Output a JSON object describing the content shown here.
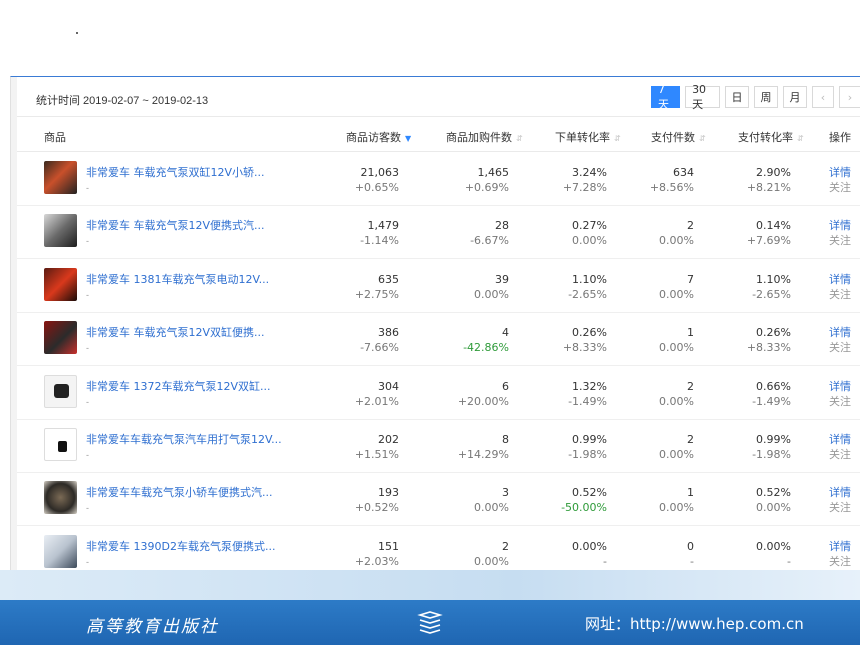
{
  "stats": {
    "time_label": "统计时间 2019-02-07 ~ 2019-02-13",
    "ranges": [
      "7天",
      "30天",
      "日",
      "周",
      "月"
    ],
    "active_range": "7天",
    "prev_icon": "chevron-left-icon",
    "next_icon": "chevron-right-icon"
  },
  "table": {
    "headers": {
      "product": "商品",
      "visitors": "商品访客数",
      "cart": "商品加购件数",
      "order_rate": "下单转化率",
      "paid_items": "支付件数",
      "pay_rate": "支付转化率",
      "ops": "操作"
    },
    "sort_active": "visitors",
    "rows": [
      {
        "name": "非常爱车 车载充气泵双缸12V小轿...",
        "dash": "-",
        "visitors": "21,063",
        "visitors_d": "+0.65%",
        "cart": "1,465",
        "cart_d": "+0.69%",
        "order_rate": "3.24%",
        "order_rate_d": "+7.28%",
        "paid": "634",
        "paid_d": "+8.56%",
        "pay_rate": "2.90%",
        "pay_rate_d": "+8.21%",
        "detail": "详情",
        "follow": "关注"
      },
      {
        "name": "非常爱车 车载充气泵12V便携式汽...",
        "dash": "-",
        "visitors": "1,479",
        "visitors_d": "-1.14%",
        "cart": "28",
        "cart_d": "-6.67%",
        "order_rate": "0.27%",
        "order_rate_d": "0.00%",
        "paid": "2",
        "paid_d": "0.00%",
        "pay_rate": "0.14%",
        "pay_rate_d": "+7.69%",
        "detail": "详情",
        "follow": "关注"
      },
      {
        "name": "非常爱车 1381车载充气泵电动12V...",
        "dash": "-",
        "visitors": "635",
        "visitors_d": "+2.75%",
        "cart": "39",
        "cart_d": "0.00%",
        "order_rate": "1.10%",
        "order_rate_d": "-2.65%",
        "paid": "7",
        "paid_d": "0.00%",
        "pay_rate": "1.10%",
        "pay_rate_d": "-2.65%",
        "detail": "详情",
        "follow": "关注"
      },
      {
        "name": "非常爱车 车载充气泵12V双缸便携...",
        "dash": "-",
        "visitors": "386",
        "visitors_d": "-7.66%",
        "cart": "4",
        "cart_d": "-42.86%",
        "cart_d_neg": true,
        "order_rate": "0.26%",
        "order_rate_d": "+8.33%",
        "paid": "1",
        "paid_d": "0.00%",
        "pay_rate": "0.26%",
        "pay_rate_d": "+8.33%",
        "detail": "详情",
        "follow": "关注"
      },
      {
        "name": "非常爱车 1372车载充气泵12V双缸...",
        "dash": "-",
        "visitors": "304",
        "visitors_d": "+2.01%",
        "cart": "6",
        "cart_d": "+20.00%",
        "order_rate": "1.32%",
        "order_rate_d": "-1.49%",
        "paid": "2",
        "paid_d": "0.00%",
        "pay_rate": "0.66%",
        "pay_rate_d": "-1.49%",
        "detail": "详情",
        "follow": "关注"
      },
      {
        "name": "非常爱车车载充气泵汽车用打气泵12V...",
        "dash": "-",
        "visitors": "202",
        "visitors_d": "+1.51%",
        "cart": "8",
        "cart_d": "+14.29%",
        "order_rate": "0.99%",
        "order_rate_d": "-1.98%",
        "paid": "2",
        "paid_d": "0.00%",
        "pay_rate": "0.99%",
        "pay_rate_d": "-1.98%",
        "detail": "详情",
        "follow": "关注"
      },
      {
        "name": "非常爱车车载充气泵小轿车便携式汽...",
        "dash": "-",
        "visitors": "193",
        "visitors_d": "+0.52%",
        "cart": "3",
        "cart_d": "0.00%",
        "order_rate": "0.52%",
        "order_rate_d": "-50.00%",
        "order_rate_d_neg": true,
        "paid": "1",
        "paid_d": "0.00%",
        "pay_rate": "0.52%",
        "pay_rate_d": "0.00%",
        "detail": "详情",
        "follow": "关注"
      },
      {
        "name": "非常爱车 1390D2车载充气泵便携式...",
        "dash": "-",
        "visitors": "151",
        "visitors_d": "+2.03%",
        "cart": "2",
        "cart_d": "0.00%",
        "order_rate": "0.00%",
        "order_rate_d": "-",
        "paid": "0",
        "paid_d": "-",
        "pay_rate": "0.00%",
        "pay_rate_d": "-",
        "detail": "详情",
        "follow": "关注"
      }
    ]
  },
  "footer": {
    "publisher": "高等教育出版社",
    "website": "网址：http://www.hep.com.cn",
    "logo_icon": "book-stack-icon"
  },
  "colors": {
    "accent": "#2f88ff",
    "link": "#2f6fd0",
    "negative": "#2f9b3a",
    "footer_bg": "#2070b8"
  }
}
